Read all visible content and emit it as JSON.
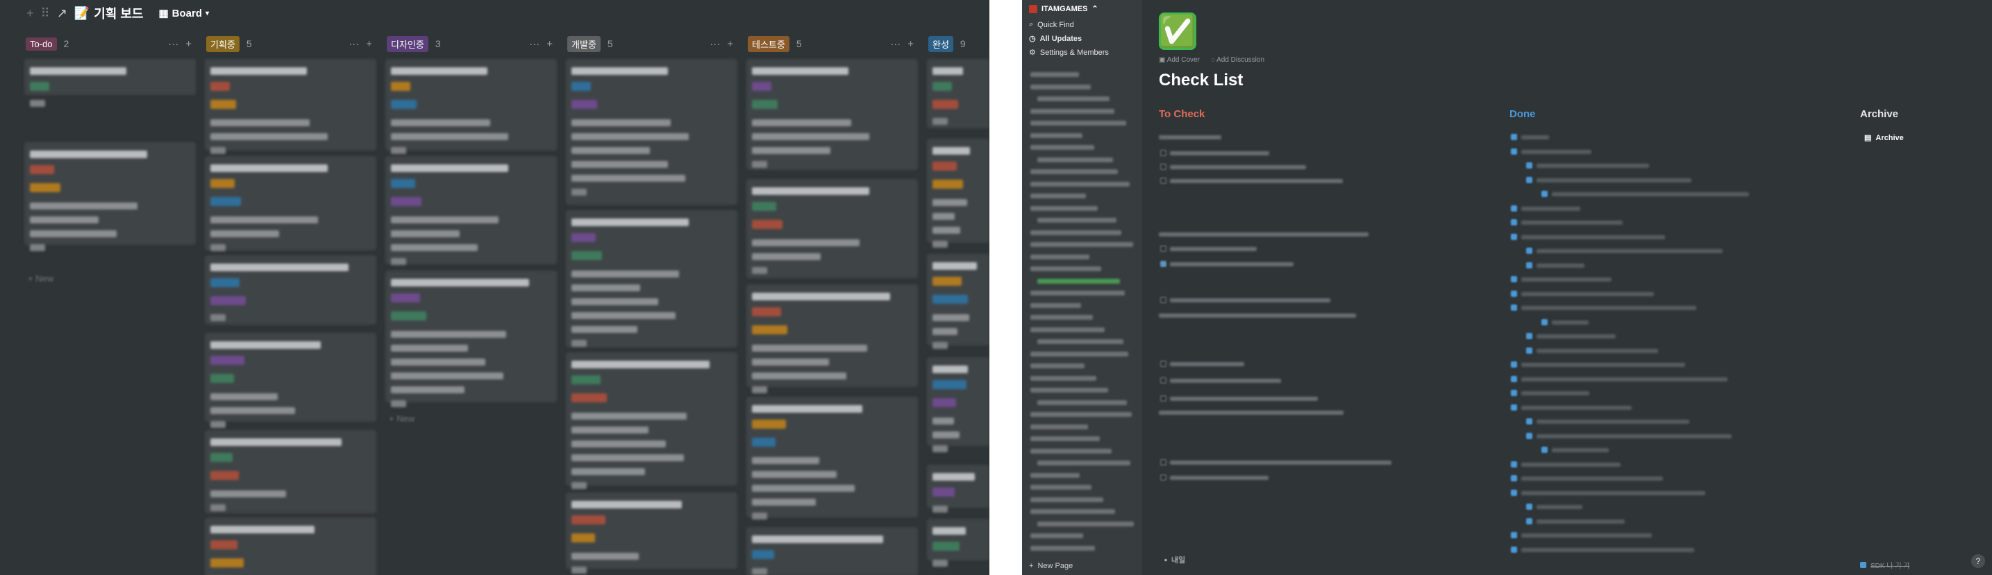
{
  "board": {
    "title": "기획 보드",
    "title_icon": "memo-icon",
    "view_label": "Board",
    "columns": [
      {
        "label": "To-do",
        "count": "2",
        "color": "#6b3b53"
      },
      {
        "label": "기획중 ",
        "count": "5",
        "color": "#8a6a1f"
      },
      {
        "label": "디자인중",
        "count": "3",
        "color": "#5a3f7a"
      },
      {
        "label": "개발중",
        "count": "5",
        "color": "#5d5f61"
      },
      {
        "label": "테스트중",
        "count": "5",
        "color": "#8a5a2b"
      },
      {
        "label": "완성",
        "count": "9",
        "color": "#2e5f86"
      }
    ],
    "new_label": "New",
    "tag_colors": [
      "#3f7a5c",
      "#a34d3c",
      "#b07a20",
      "#2f6f9a",
      "#6d4b8c"
    ]
  },
  "page": {
    "workspace": "ITAMGAMES",
    "sidebar_items": [
      {
        "label": "Quick Find",
        "icon": "search-icon"
      },
      {
        "label": "All Updates",
        "icon": "clock-icon"
      },
      {
        "label": "Settings & Members",
        "icon": "gear-icon"
      }
    ],
    "new_page_label": "New Page",
    "emoji": "✅",
    "add_cover": "Add Cover",
    "add_discussion": "Add Discussion",
    "title": "Check List",
    "columns": [
      {
        "label": "To Check",
        "color": "#e06c5a"
      },
      {
        "label": "Done",
        "color": "#4b9ad8"
      },
      {
        "label": "Archive",
        "color": "#e6e6e6"
      }
    ],
    "archive_item": "Archive",
    "todo_bullet_1": "내일",
    "done_last_item": "SDK 나 기 기",
    "help": "?"
  }
}
